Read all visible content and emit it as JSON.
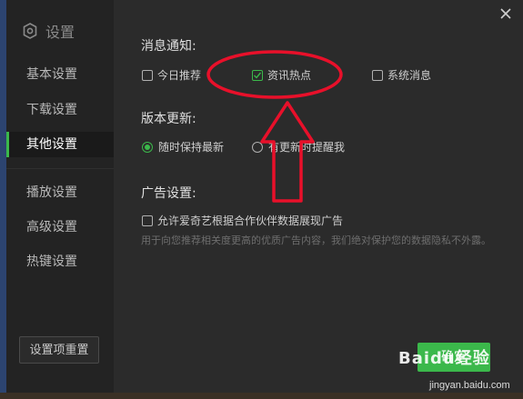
{
  "sidebar": {
    "title": "设置",
    "items": [
      {
        "label": "基本设置"
      },
      {
        "label": "下载设置"
      },
      {
        "label": "其他设置"
      },
      {
        "label": "播放设置"
      },
      {
        "label": "高级设置"
      },
      {
        "label": "热键设置"
      }
    ],
    "active_index": 2,
    "reset_label": "设置项重置"
  },
  "main": {
    "notify": {
      "title": "消息通知:",
      "options": [
        {
          "label": "今日推荐",
          "checked": false
        },
        {
          "label": "资讯热点",
          "checked": true
        },
        {
          "label": "系统消息",
          "checked": false
        }
      ]
    },
    "update": {
      "title": "版本更新:",
      "options": [
        {
          "label": "随时保持最新",
          "selected": true
        },
        {
          "label": "有更新时提醒我",
          "selected": false
        }
      ]
    },
    "ads": {
      "title": "广告设置:",
      "checkbox_label": "允许爱奇艺根据合作伙伴数据展现广告",
      "checked": false,
      "hint": "用于向您推荐相关度更高的优质广告内容，我们绝对保护您的数据隐私不外露。"
    },
    "ok_label": "确定"
  },
  "watermark": {
    "brand": "Baidu经验",
    "url": "jingyan.baidu.com"
  },
  "colors": {
    "accent": "#3bb84b",
    "annotation": "#e8102a",
    "background": "#2b2b2b",
    "sidebar": "#232323"
  }
}
